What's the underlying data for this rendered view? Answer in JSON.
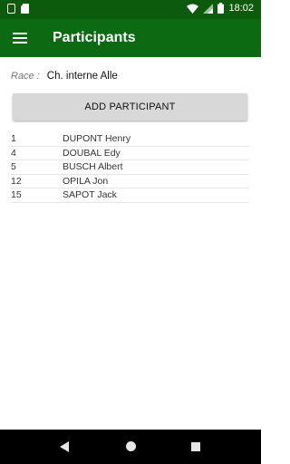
{
  "status_bar": {
    "time": "18:02"
  },
  "app_bar": {
    "title": "Participants"
  },
  "race": {
    "label": "Race :",
    "value": "Ch. interne Alle"
  },
  "actions": {
    "add_participant_label": "ADD PARTICIPANT"
  },
  "participants": [
    {
      "number": "1",
      "name": "DUPONT Henry"
    },
    {
      "number": "4",
      "name": "DOUBAL Edy"
    },
    {
      "number": "5",
      "name": "BUSCH Albert"
    },
    {
      "number": "12",
      "name": "OPILA Jon"
    },
    {
      "number": "15",
      "name": "SAPOT Jack"
    }
  ],
  "colors": {
    "status_bar": "#0c5a0c",
    "app_bar": "#0c6b12",
    "button_bg": "#d8d8d8"
  },
  "icons": [
    "notification-icon",
    "sd-card-icon",
    "wifi-icon",
    "signal-icon",
    "battery-icon",
    "menu-icon",
    "back-icon",
    "home-icon",
    "recents-icon"
  ]
}
